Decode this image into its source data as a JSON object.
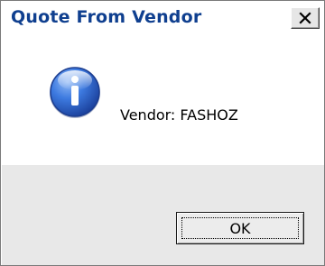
{
  "window": {
    "title": "Quote From Vendor",
    "close_icon": "close-x"
  },
  "message": {
    "icon": "information-icon",
    "text": "Vendor: FASHOZ"
  },
  "buttons": {
    "ok_label": "OK"
  },
  "colors": {
    "title_text": "#0f3f8f",
    "footer_bg": "#e8e8e8",
    "icon_blue": "#2a64c8"
  }
}
